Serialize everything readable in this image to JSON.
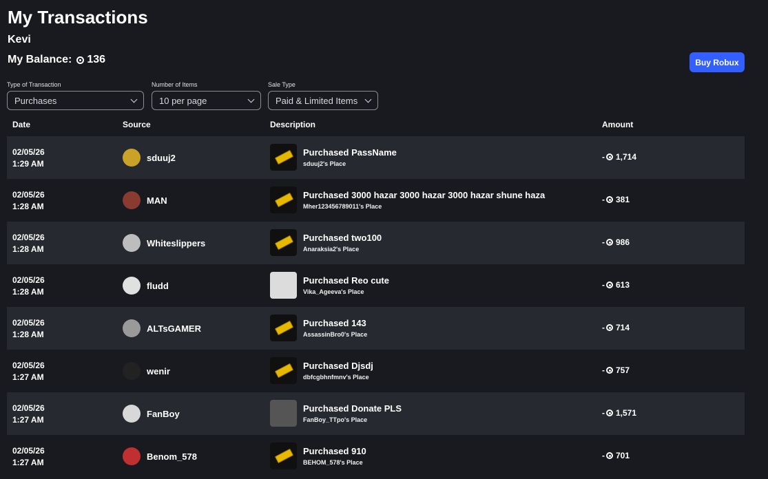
{
  "page": {
    "title": "My Transactions",
    "username": "Kevi",
    "balance_label": "My Balance:",
    "balance_value": "136",
    "buy_button": "Buy Robux"
  },
  "filters": [
    {
      "label": "Type of Transaction",
      "value": "Purchases"
    },
    {
      "label": "Number of Items",
      "value": "10 per page"
    },
    {
      "label": "Sale Type",
      "value": "Paid & Limited Items"
    }
  ],
  "table": {
    "headers": {
      "date": "Date",
      "source": "Source",
      "description": "Description",
      "amount": "Amount"
    },
    "rows": [
      {
        "date": "02/05/26",
        "time": "1:29 AM",
        "source": "sduuj2",
        "description": "Purchased PassName",
        "place": "sduuj2's Place",
        "amount": "1,714"
      },
      {
        "date": "02/05/26",
        "time": "1:28 AM",
        "source": "MAN",
        "description": "Purchased 3000 hazar 3000 hazar 3000 hazar shune haza",
        "place": "Mher123456789011's Place",
        "amount": "381"
      },
      {
        "date": "02/05/26",
        "time": "1:28 AM",
        "source": "Whiteslippers",
        "description": "Purchased two100",
        "place": "Anaraksia2's Place",
        "amount": "986"
      },
      {
        "date": "02/05/26",
        "time": "1:28 AM",
        "source": "fludd",
        "description": "Purchased Reo cute",
        "place": "Vika_Ageeva's Place",
        "amount": "613"
      },
      {
        "date": "02/05/26",
        "time": "1:28 AM",
        "source": "ALTsGAMER",
        "description": "Purchased 143",
        "place": "AssassinBro0's Place",
        "amount": "714"
      },
      {
        "date": "02/05/26",
        "time": "1:27 AM",
        "source": "wenir",
        "description": "Purchased Djsdj",
        "place": "dbfcgbhnfmnv's Place",
        "amount": "757"
      },
      {
        "date": "02/05/26",
        "time": "1:27 AM",
        "source": "FanBoy",
        "description": "Purchased Donate PLS",
        "place": "FanBoy_TTpo's Place",
        "amount": "1,571"
      },
      {
        "date": "02/05/26",
        "time": "1:27 AM",
        "source": "Benom_578",
        "description": "Purchased 910",
        "place": "BEHOM_578's Place",
        "amount": "701"
      }
    ]
  },
  "amount_prefix": "-",
  "icons": {
    "currency": "robux-icon",
    "dropdown": "chevron-down-icon"
  },
  "colors": {
    "background": "#191a1f",
    "row_alt": "#272930",
    "accent": "#335fff"
  }
}
